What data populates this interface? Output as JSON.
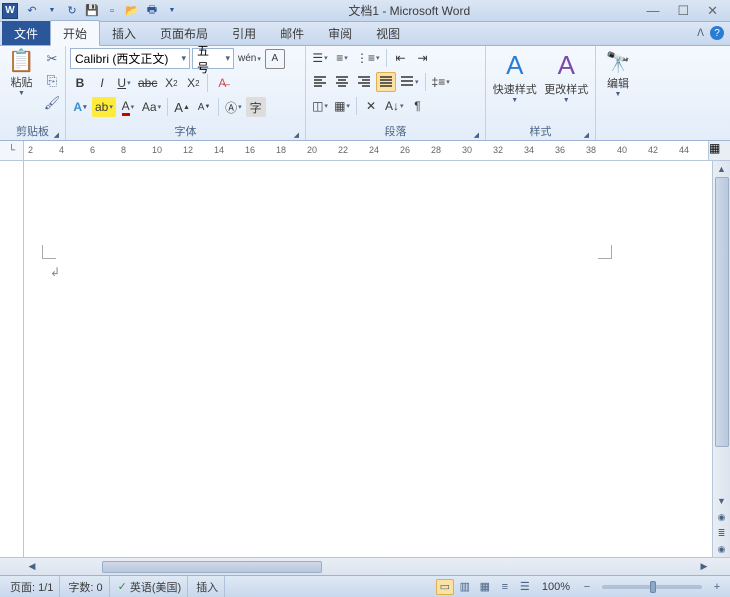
{
  "title": "文档1 - Microsoft Word",
  "qat": {
    "save_tip": "保存"
  },
  "tabs": {
    "file": "文件",
    "home": "开始",
    "insert": "插入",
    "layout": "页面布局",
    "references": "引用",
    "mail": "邮件",
    "review": "审阅",
    "view": "视图"
  },
  "clipboard": {
    "paste": "粘贴",
    "label": "剪贴板"
  },
  "font": {
    "name": "Calibri (西文正文)",
    "size": "五号",
    "label": "字体"
  },
  "paragraph": {
    "label": "段落"
  },
  "styles": {
    "quick": "快速样式",
    "change": "更改样式",
    "label": "样式"
  },
  "editing": {
    "label": "编辑",
    "find": "查找"
  },
  "ruler": {
    "numbers": [
      "2",
      "4",
      "6",
      "8",
      "10",
      "12",
      "14",
      "16",
      "18",
      "20",
      "22",
      "24",
      "26",
      "28",
      "30",
      "32",
      "34",
      "36",
      "38",
      "40",
      "42",
      "44"
    ]
  },
  "status": {
    "page": "页面: 1/1",
    "words": "字数: 0",
    "lang": "英语(美国)",
    "mode": "插入",
    "zoom": "100%"
  }
}
